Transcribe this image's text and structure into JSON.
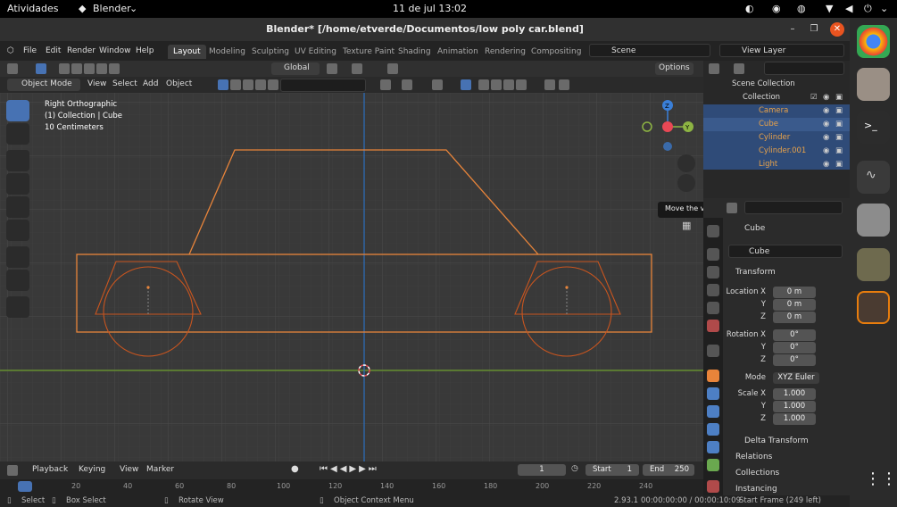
{
  "gnome": {
    "activities": "Atividades",
    "app": "Blender",
    "datetime": "11 de jul  13:02"
  },
  "window": {
    "title": "Blender* [/home/etverde/Documentos/low poly car.blend]"
  },
  "menu": [
    "File",
    "Edit",
    "Render",
    "Window",
    "Help"
  ],
  "workspaces": [
    "Layout",
    "Modeling",
    "Sculpting",
    "UV Editing",
    "Texture Paint",
    "Shading",
    "Animation",
    "Rendering",
    "Compositing"
  ],
  "scene": "Scene",
  "view_layer": "View Layer",
  "header1": {
    "orientation": "Global",
    "options": "Options"
  },
  "header2": {
    "mode": "Object Mode",
    "menus": [
      "View",
      "Select",
      "Add",
      "Object"
    ]
  },
  "viewport": {
    "view_name": "Right Orthographic",
    "collection_info": "(1) Collection | Cube",
    "scale": "10 Centimeters",
    "tooltip": "Move the view"
  },
  "outliner": {
    "root": "Scene Collection",
    "collection": "Collection",
    "items": [
      "Camera",
      "Cube",
      "Cylinder",
      "Cylinder.001",
      "Light"
    ]
  },
  "properties": {
    "object_name": "Cube",
    "data_name": "Cube",
    "transform_label": "Transform",
    "location_label": "Location X",
    "rotation_label": "Rotation X",
    "scale_label": "Scale X",
    "y": "Y",
    "z": "Z",
    "location": [
      "0 m",
      "0 m",
      "0 m"
    ],
    "rotation": [
      "0°",
      "0°",
      "0°"
    ],
    "mode_label": "Mode",
    "mode": "XYZ Euler",
    "scale": [
      "1.000",
      "1.000",
      "1.000"
    ],
    "delta": "Delta Transform",
    "relations": "Relations",
    "collections": "Collections",
    "instancing": "Instancing"
  },
  "timeline": {
    "playback": "Playback",
    "keying": "Keying",
    "view": "View",
    "marker": "Marker",
    "current_frame": "1",
    "start_label": "Start",
    "start": "1",
    "end_label": "End",
    "end": "250",
    "ruler": [
      "20",
      "40",
      "60",
      "80",
      "100",
      "120",
      "140",
      "160",
      "180",
      "200",
      "220",
      "240"
    ]
  },
  "status": {
    "select": "Select",
    "box_select": "Box Select",
    "rotate": "Rotate View",
    "context": "Object Context Menu",
    "version": "2.93.1",
    "time": "00:00:00:00 / 00:00:10:09",
    "frame": "Start Frame (249 left)"
  },
  "colors": {
    "accent": "#4772b3",
    "selection": "#e8843a",
    "x_axis": "#e84855",
    "y_axis": "#8db443",
    "z_axis": "#3a7fd8"
  }
}
